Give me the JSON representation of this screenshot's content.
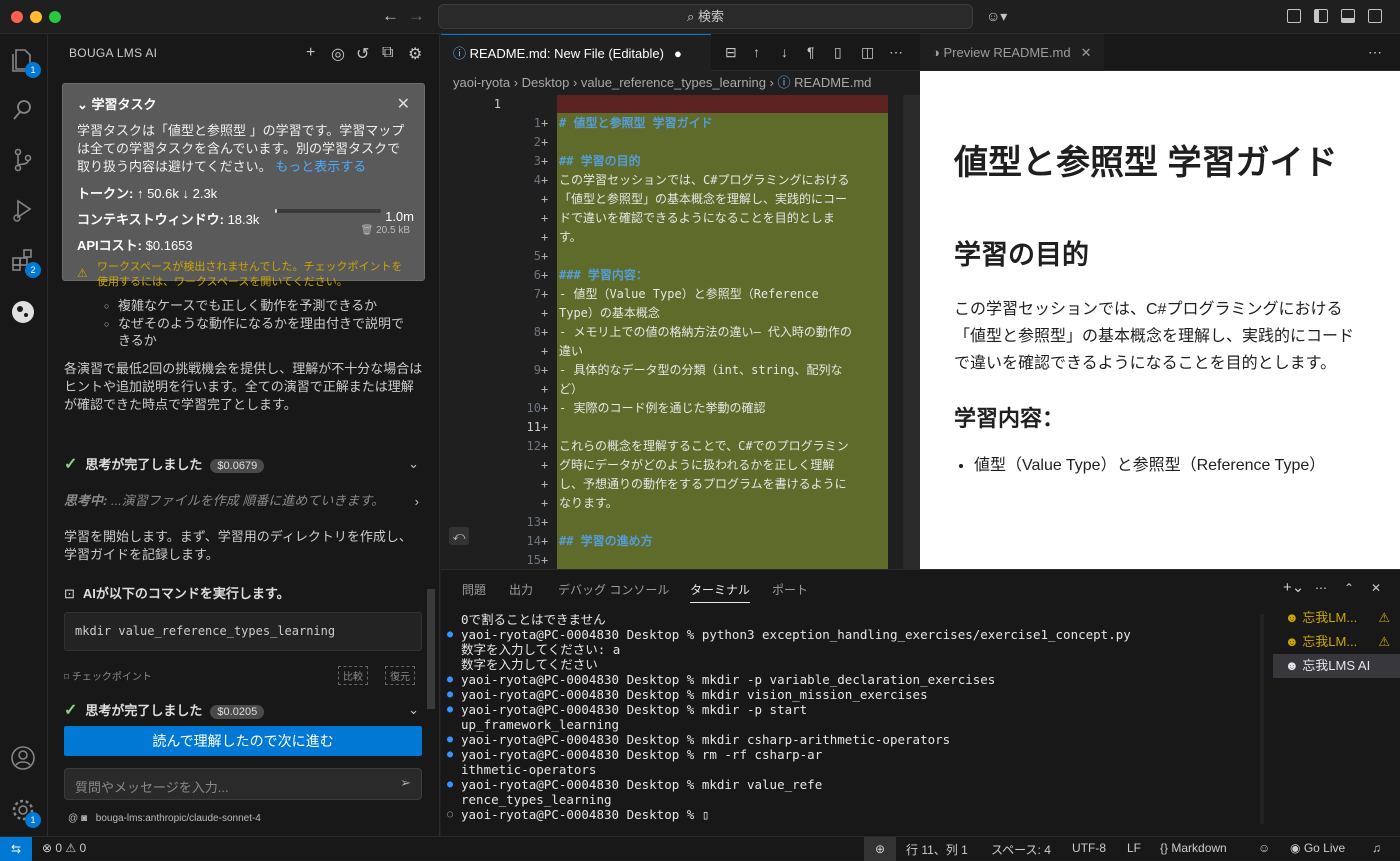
{
  "window": {
    "search_placeholder": "検索"
  },
  "activity_bar": {
    "explorer_badge": "1",
    "extensions_badge": "2",
    "settings_badge": "1"
  },
  "panel": {
    "title": "BOUGA LMS AI",
    "task": {
      "heading": "学習タスク",
      "description": "学習タスクは「値型と参照型 」の学習です。学習マップは全ての学習タスクを含んでいます。別の学習タスクで取り扱う内容は避けてください。",
      "more": "もっと表示する",
      "tokens_label": "トークン:",
      "tokens_value": "↑ 50.6k ↓ 2.3k",
      "context_label": "コンテキストウィンドウ:",
      "context_used": "18.3k",
      "context_max": "1.0m",
      "context_fill": 0.02,
      "api_label": "APIコスト:",
      "api_value": "$0.1653",
      "size": "20.5 kB",
      "warning": "ワークスペースが検出されませんでした。チェックポイントを使用するには、ワークスペースを開いてください。"
    },
    "bullets": [
      "複雑なケースでも正しく動作を予測できるか",
      "なぜそのような動作になるかを理由付きで説明できるか"
    ],
    "para1": "各演習で最低2回の挑戦機会を提供し、理解が不十分な場合はヒントや追加説明を行います。全ての演習で正解または理解が確認できた時点で学習完了とします。",
    "think1_label": "思考が完了しました",
    "think1_cost": "$0.0679",
    "thinking_label": "思考中:",
    "thinking_text": "...演習ファイルを作成 順番に進めていきます。",
    "para2": "学習を開始します。まず、学習用のディレクトリを作成し、学習ガイドを記録します。",
    "command_heading": "AIが以下のコマンドを実行します。",
    "command": "mkdir value_reference_types_learning",
    "checkpoint_label": "チェックポイント",
    "compare_label": "比較",
    "restore_label": "復元",
    "think2_label": "思考が完了しました",
    "think2_cost": "$0.0205",
    "primary_button": "読んで理解したので次に進む",
    "input_placeholder": "質問やメッセージを入力...",
    "model": "bouga-lms:anthropic/claude-sonnet-4"
  },
  "editor": {
    "tab_label": "README.md: New File (Editable)",
    "breadcrumbs": [
      "yaoi-ryota",
      "Desktop",
      "value_reference_types_learning",
      "README.md"
    ],
    "lines": [
      {
        "n": "1",
        "text": "# 値型と参照型 学習ガイド",
        "h": true
      },
      {
        "n": "2",
        "text": "",
        "h": false
      },
      {
        "n": "3",
        "text": "## 学習の目的",
        "h": true
      },
      {
        "n": "4",
        "text": "この学習セッションでは、C#プログラミングにおける",
        "h": false
      },
      {
        "n": "",
        "text": "「値型と参照型」の基本概念を理解し、実践的にコー",
        "h": false
      },
      {
        "n": "",
        "text": "ドで違いを確認できるようになることを目的としま",
        "h": false
      },
      {
        "n": "",
        "text": "す。",
        "h": false
      },
      {
        "n": "5",
        "text": "",
        "h": false
      },
      {
        "n": "6",
        "text": "### 学習内容：",
        "h": true
      },
      {
        "n": "7",
        "text": "- 値型（Value Type）と参照型（Reference",
        "h": false
      },
      {
        "n": "",
        "text": "Type）の基本概念",
        "h": false
      },
      {
        "n": "8",
        "text": "- メモリ上での値の格納方法の違い– 代入時の動作の",
        "h": false
      },
      {
        "n": "",
        "text": "違い",
        "h": false
      },
      {
        "n": "9",
        "text": "- 具体的なデータ型の分類（int、string、配列な",
        "h": false
      },
      {
        "n": "",
        "text": "ど）",
        "h": false
      },
      {
        "n": "10",
        "text": "- 実際のコード例を通じた挙動の確認",
        "h": false
      },
      {
        "n": "11",
        "text": "",
        "h": false
      },
      {
        "n": "12",
        "text": "これらの概念を理解することで、C#でのプログラミン",
        "h": false
      },
      {
        "n": "",
        "text": "グ時にデータがどのように扱われるかを正しく理解",
        "h": false
      },
      {
        "n": "",
        "text": "し、予想通りの動作をするプログラムを書けるように",
        "h": false
      },
      {
        "n": "",
        "text": "なります。",
        "h": false
      },
      {
        "n": "13",
        "text": "",
        "h": false
      },
      {
        "n": "14",
        "text": "## 学習の進め方",
        "h": true
      },
      {
        "n": "15",
        "text": "",
        "h": false
      }
    ],
    "original_line": "1"
  },
  "preview": {
    "tab_label": "Preview README.md",
    "h1": "値型と参照型 学習ガイド",
    "h2": "学習の目的",
    "p": "この学習セッションでは、C#プログラミングにおける「値型と参照型」の基本概念を理解し、実践的にコードで違いを確認できるようになることを目的とします。",
    "h3": "学習内容：",
    "li": "値型（Value Type）と参照型（Reference Type）"
  },
  "terminal": {
    "tabs": [
      "問題",
      "出力",
      "デバッグ コンソール",
      "ターミナル",
      "ポート"
    ],
    "lines": [
      {
        "t": "0で割ることはできません",
        "m": ""
      },
      {
        "t": "yaoi-ryota@PC-0004830 Desktop % python3 exception_handling_exercises/exercise1_concept.py",
        "m": "dot"
      },
      {
        "t": "数字を入力してください: a",
        "m": ""
      },
      {
        "t": "数字を入力してください",
        "m": ""
      },
      {
        "t": "yaoi-ryota@PC-0004830 Desktop % mkdir -p variable_declaration_exercises",
        "m": "dot"
      },
      {
        "t": "yaoi-ryota@PC-0004830 Desktop % mkdir vision_mission_exercises",
        "m": "dot"
      },
      {
        "t": "yaoi-ryota@PC-0004830 Desktop % mkdir -p start",
        "m": "dot"
      },
      {
        "t": "up_framework_learning",
        "m": ""
      },
      {
        "t": "yaoi-ryota@PC-0004830 Desktop % mkdir csharp-arithmetic-operators",
        "m": "dot"
      },
      {
        "t": "yaoi-ryota@PC-0004830 Desktop % rm -rf csharp-ar",
        "m": "dot"
      },
      {
        "t": "ithmetic-operators",
        "m": ""
      },
      {
        "t": "yaoi-ryota@PC-0004830 Desktop % mkdir value_refe",
        "m": "dot"
      },
      {
        "t": "rence_types_learning",
        "m": ""
      },
      {
        "t": "yaoi-ryota@PC-0004830 Desktop % ▯",
        "m": "odot"
      }
    ],
    "instances": [
      "忘我LM...",
      "忘我LM...",
      "忘我LMS AI"
    ]
  },
  "statusbar": {
    "errors": "0",
    "warnings": "0",
    "position": "行 11、列 1",
    "spaces": "スペース: 4",
    "encoding": "UTF-8",
    "eol": "LF",
    "language": "Markdown",
    "golive": "Go Live"
  }
}
